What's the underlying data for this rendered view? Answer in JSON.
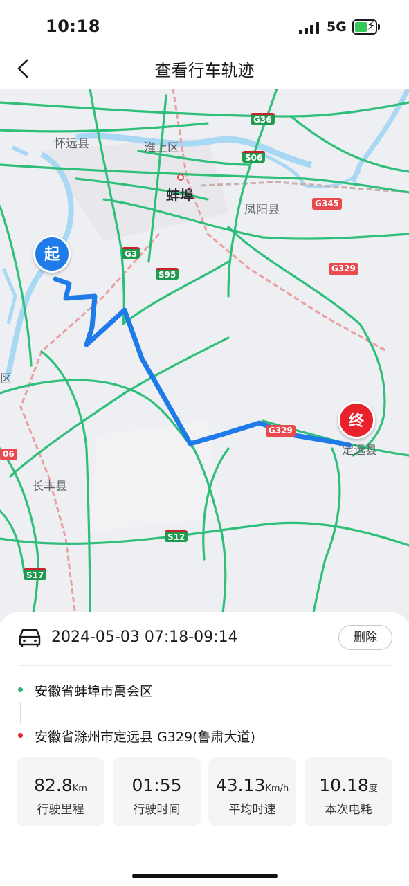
{
  "status_bar": {
    "time": "10:18",
    "network": "5G",
    "icons": [
      "signal-icon",
      "battery-charging-icon"
    ]
  },
  "nav": {
    "title": "查看行车轨迹",
    "back_icon": "chevron-left-icon"
  },
  "map": {
    "labels": {
      "huaiyuan": "怀远县",
      "huaishang": "淮上区",
      "bengbu": "蚌埠",
      "fengyang": "凤阳县",
      "changfeng": "长丰县",
      "dingyuan": "定远县",
      "edge_left": "区"
    },
    "shields": {
      "g36": "G36",
      "s06_top": "S06",
      "g345": "G345",
      "g3": "G3",
      "s95": "S95",
      "g329_east": "G329",
      "g329_route": "G329",
      "s12": "S12",
      "s17": "S17",
      "s06_left": "06"
    },
    "start_marker": "起",
    "end_marker": "终",
    "colors": {
      "route": "#1f7be8",
      "highway": "#2fbf7a",
      "water": "#a9d8f5",
      "rail": "#e8a0a0",
      "start": "#1f7be8",
      "end": "#e8212d"
    }
  },
  "trip": {
    "car_icon": "car-icon",
    "time_range": "2024-05-03 07:18-09:14",
    "delete_label": "删除",
    "start_location": "安徽省蚌埠市禹会区",
    "end_location": "安徽省滁州市定远县 G329(鲁肃大道)",
    "start_dot_color": "#2bb673",
    "end_dot_color": "#e8212d"
  },
  "stats": [
    {
      "value": "82.8",
      "unit": "Km",
      "label": "行驶里程"
    },
    {
      "value": "01:55",
      "unit": "",
      "label": "行驶时间"
    },
    {
      "value": "43.13",
      "unit": "Km/h",
      "label": "平均时速"
    },
    {
      "value": "10.18",
      "unit": "度",
      "label": "本次电耗"
    }
  ]
}
